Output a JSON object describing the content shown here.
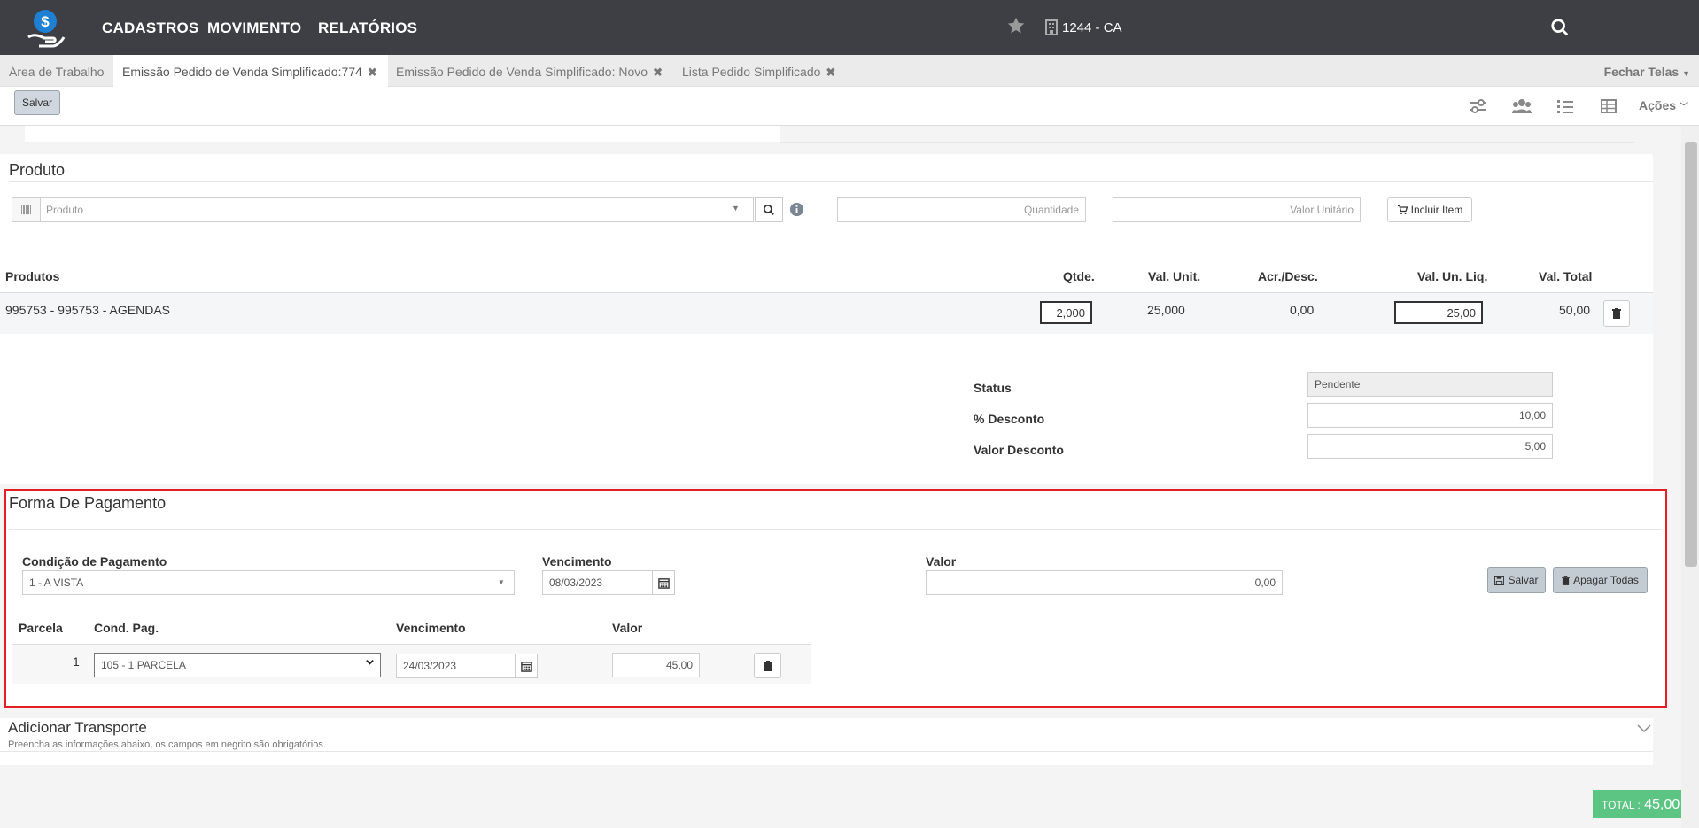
{
  "header": {
    "nav": [
      "CADASTROS",
      "MOVIMENTO",
      "RELATÓRIOS"
    ],
    "branch": "1244 - CA"
  },
  "tabs": [
    {
      "label": "Área de Trabalho",
      "closable": false
    },
    {
      "label": "Emissão Pedido de Venda Simplificado:774",
      "closable": true,
      "active": true
    },
    {
      "label": "Emissão Pedido de Venda Simplificado: Novo",
      "closable": true
    },
    {
      "label": "Lista Pedido Simplificado",
      "closable": true
    }
  ],
  "close_all": "Fechar Telas",
  "toolbar": {
    "save_label": "Salvar",
    "actions_label": "Ações"
  },
  "produto": {
    "title": "Produto",
    "search_placeholder": "Produto",
    "qty_placeholder": "Quantidade",
    "unit_value_placeholder": "Valor Unitário",
    "add_button": "Incluir Item"
  },
  "items_table": {
    "headers": {
      "produtos": "Produtos",
      "qtde": "Qtde.",
      "val_unit": "Val. Unit.",
      "acr_desc": "Acr./Desc.",
      "val_un_liq": "Val. Un. Liq.",
      "val_total": "Val. Total"
    },
    "rows": [
      {
        "produto": "995753 - 995753 - AGENDAS",
        "qtde": "2,000",
        "val_unit": "25,000",
        "acr_desc": "0,00",
        "val_un_liq": "25,00",
        "val_total": "50,00"
      }
    ]
  },
  "summary": {
    "status_label": "Status",
    "status_value": "Pendente",
    "desconto_pct_label": "% Desconto",
    "desconto_pct_value": "10,00",
    "desconto_valor_label": "Valor Desconto",
    "desconto_valor_value": "5,00"
  },
  "pagamento": {
    "title": "Forma De Pagamento",
    "condicao_label": "Condição de Pagamento",
    "condicao_value": "1 - A VISTA",
    "vencimento_label": "Vencimento",
    "vencimento_value": "08/03/2023",
    "valor_label": "Valor",
    "valor_value": "0,00",
    "save_button": "Salvar",
    "delete_all_button": "Apagar Todas",
    "parcelas_headers": {
      "parcela": "Parcela",
      "cond_pag": "Cond. Pag.",
      "vencimento": "Vencimento",
      "valor": "Valor"
    },
    "parcelas": [
      {
        "parcela": "1",
        "cond_pag": "105 - 1 PARCELA",
        "vencimento": "24/03/2023",
        "valor": "45,00"
      }
    ]
  },
  "transporte": {
    "title": "Adicionar Transporte",
    "subtitle": "Preencha as informações abaixo, os campos em negrito são obrigatórios."
  },
  "total": {
    "label": "TOTAL :",
    "value": "45,00"
  },
  "colors": {
    "topbar": "#3d3f44",
    "highlight": "#e41e26",
    "total": "#5cc583"
  }
}
